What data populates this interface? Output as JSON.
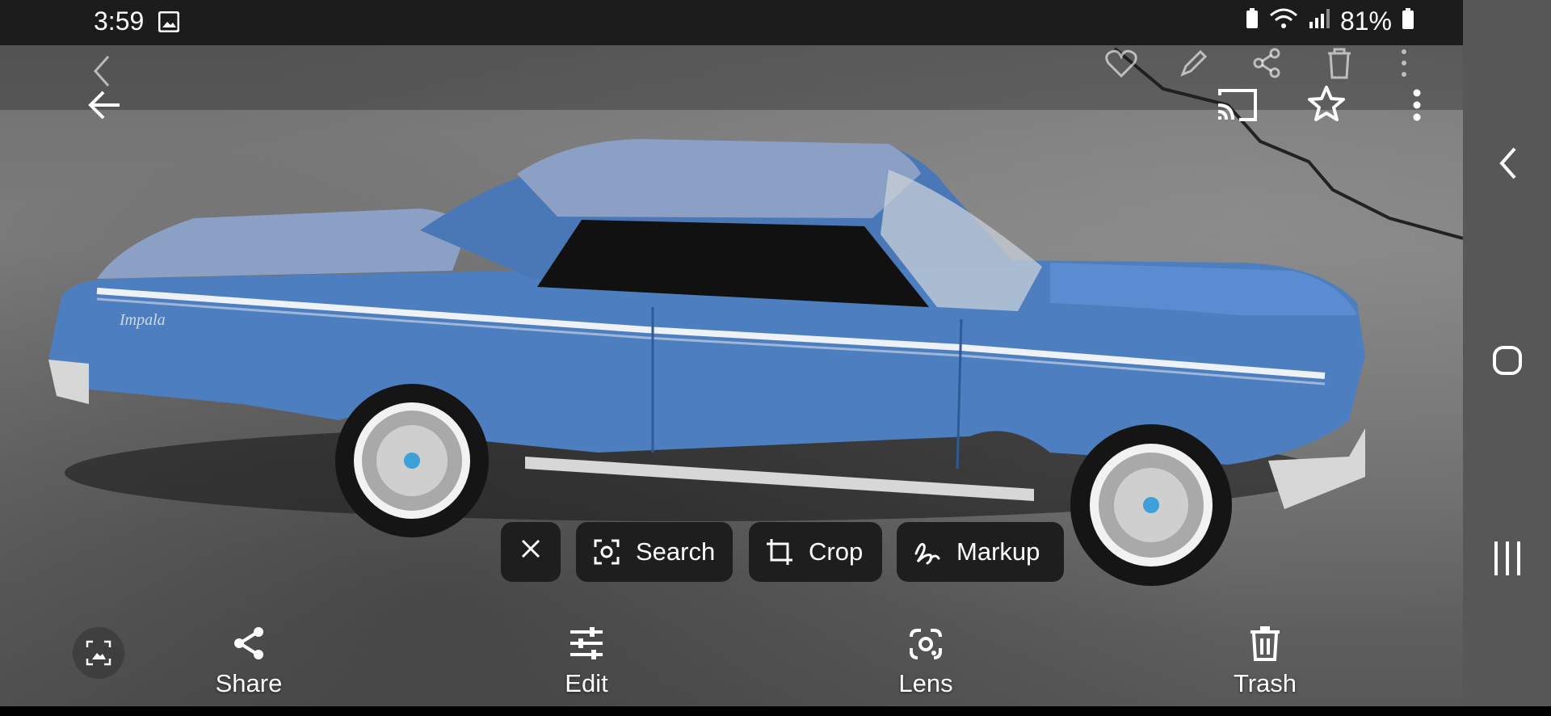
{
  "status_bar": {
    "time": "3:59",
    "gallery_notification_icon": "image-icon",
    "battery_percent": "81%",
    "icons": [
      "battery-saver-icon",
      "wifi-icon",
      "signal-icon",
      "battery-icon"
    ]
  },
  "ghost_toolbar": {
    "icons": [
      "back-chevron-icon",
      "heart-icon",
      "pencil-icon",
      "share-icon",
      "trash-icon",
      "more-vert-icon"
    ]
  },
  "top_bar": {
    "icons": [
      "back-arrow-icon",
      "cast-icon",
      "star-icon",
      "more-vert-icon"
    ]
  },
  "photo": {
    "subject": "blue model car",
    "emblem_text": "Impala",
    "colors": {
      "body": "#4d7fc0",
      "roof": "#8c9fc4",
      "chrome": "#d7d7d7"
    }
  },
  "lens_chips": [
    {
      "id": "close",
      "label": "",
      "icon": "close-icon"
    },
    {
      "id": "search",
      "label": "Search",
      "icon": "lens-search-icon"
    },
    {
      "id": "crop",
      "label": "Crop",
      "icon": "crop-icon"
    },
    {
      "id": "markup",
      "label": "Markup",
      "icon": "markup-icon"
    }
  ],
  "bottom_actions": [
    {
      "id": "share",
      "label": "Share",
      "icon": "share-icon"
    },
    {
      "id": "edit",
      "label": "Edit",
      "icon": "sliders-icon"
    },
    {
      "id": "lens",
      "label": "Lens",
      "icon": "lens-icon"
    },
    {
      "id": "trash",
      "label": "Trash",
      "icon": "trash-icon"
    }
  ],
  "nav_bar": {
    "icons": [
      "nav-back-icon",
      "nav-home-icon",
      "nav-recents-icon"
    ]
  }
}
